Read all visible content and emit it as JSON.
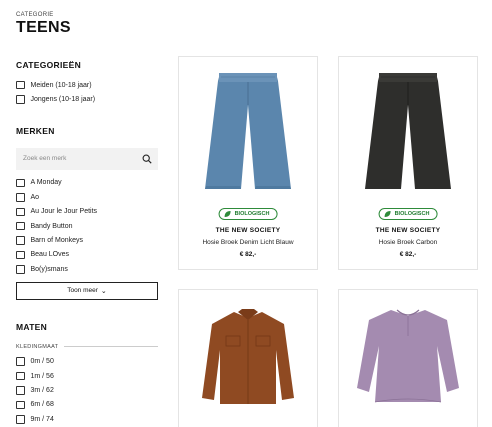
{
  "header": {
    "eyebrow": "CATEGORIE",
    "title": "TEENS"
  },
  "categories": {
    "title": "CATEGORIEËN",
    "items": [
      "Meiden (10-18 jaar)",
      "Jongens (10-18 jaar)"
    ]
  },
  "brands": {
    "title": "MERKEN",
    "search_placeholder": "Zoek een merk",
    "items": [
      "A Monday",
      "Ao",
      "Au Jour le Jour Petits",
      "Bandy Button",
      "Barn of Monkeys",
      "Beau LOves",
      "Bo(y)smans"
    ],
    "more_label": "Toon meer"
  },
  "sizes": {
    "title": "MATEN",
    "subtitle": "KLEDINGMAAT",
    "items": [
      "0m / 50",
      "1m / 56",
      "3m / 62",
      "6m / 68",
      "9m / 74"
    ]
  },
  "products": [
    {
      "badge": "BIOLOGISCH",
      "brand": "THE NEW SOCIETY",
      "name": "Hosie Broek Denim Licht Blauw",
      "price": "€ 82,-",
      "color": "#5b86ad"
    },
    {
      "badge": "BIOLOGISCH",
      "brand": "THE NEW SOCIETY",
      "name": "Hosie Broek Carbon",
      "price": "€ 82,-",
      "color": "#2e2e2c"
    },
    {
      "color": "#8f4a22"
    },
    {
      "color": "#a48bb0"
    }
  ],
  "colors": {
    "badge_green": "#2e8b3a",
    "border": "#e4e4e4"
  }
}
